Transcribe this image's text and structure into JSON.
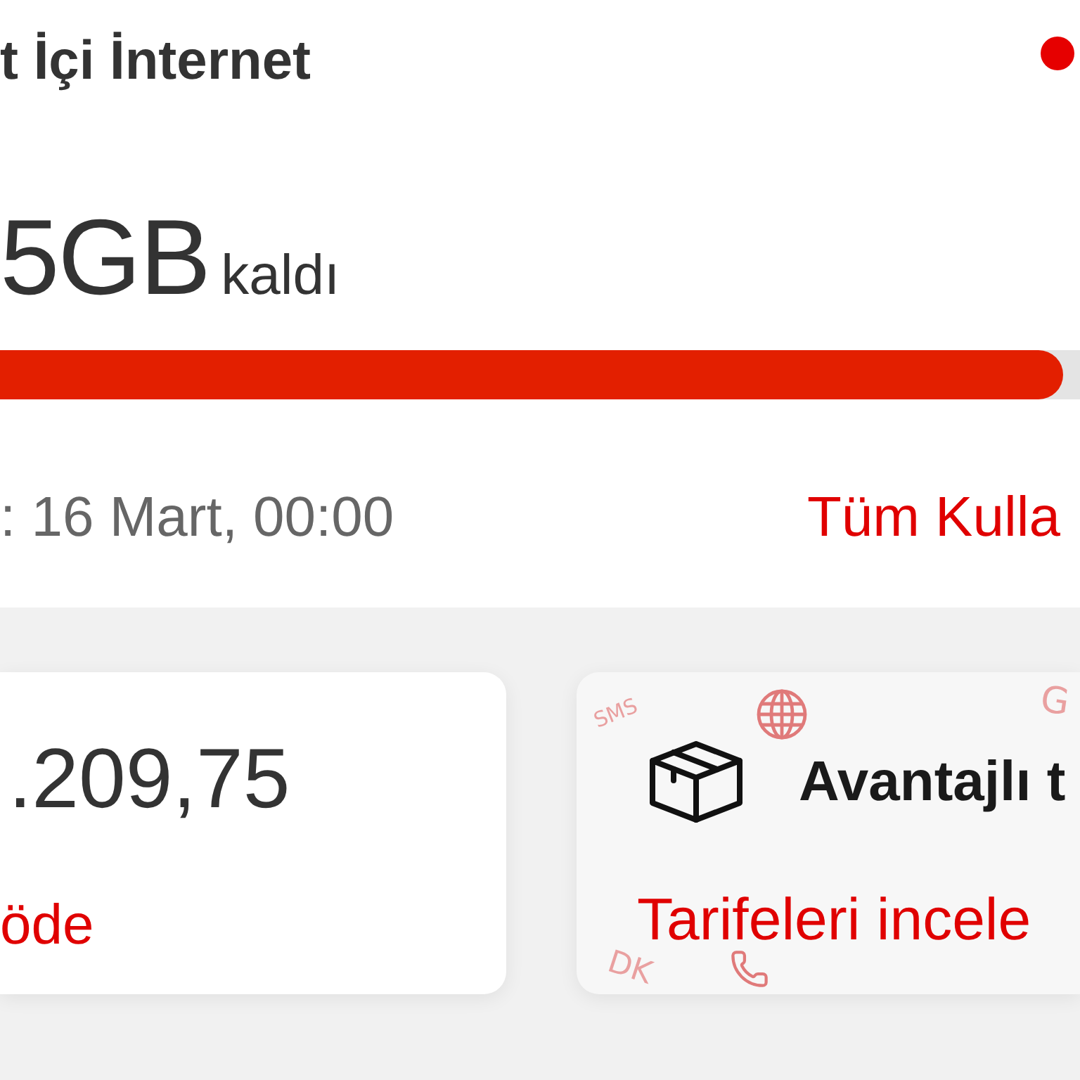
{
  "usage": {
    "title": "t İçi İnternet",
    "amount": "5GB",
    "amount_label": "kaldı",
    "level": 0.985,
    "renewal": ": 16 Mart, 00:00",
    "link": "Tüm Kulla"
  },
  "cards": [
    {
      "kind": "bill",
      "amount": ".209,75",
      "action": "öde"
    },
    {
      "kind": "promo",
      "title": "Avantajlı t",
      "action": "Tarifeleri incele",
      "pattern": [
        "SMS",
        "G",
        "DK"
      ]
    }
  ]
}
